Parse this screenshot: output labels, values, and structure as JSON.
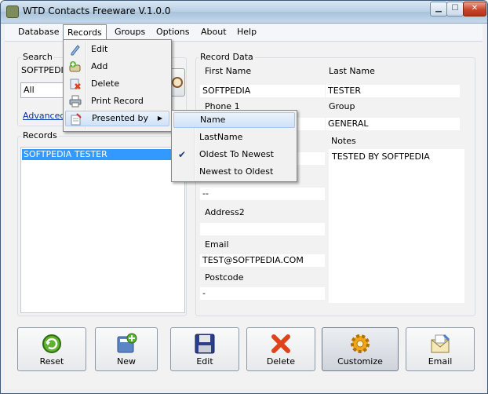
{
  "window": {
    "title": "WTD Contacts Freeware V.1.0.0",
    "min_glyph": "▁",
    "max_glyph": "☐",
    "close_glyph": "✕"
  },
  "menu": [
    {
      "label": "Database"
    },
    {
      "label": "Records"
    },
    {
      "label": "Groups"
    },
    {
      "label": "Options"
    },
    {
      "label": "About"
    },
    {
      "label": "Help"
    }
  ],
  "search": {
    "group_label": "Search",
    "value": "SOFTPEDIA",
    "scope": "All",
    "advanced_link": "Advanced"
  },
  "records": {
    "group_label": "Records",
    "items": [
      "SOFTPEDIA  TESTER"
    ]
  },
  "record_data": {
    "group_label": "Record Data",
    "first_name_label": "First Name",
    "first_name": "SOFTPEDIA",
    "last_name_label": "Last Name",
    "last_name": "TESTER",
    "phone1_label": "Phone 1",
    "phone1": "",
    "group_label_field": "Group",
    "group": "GENERAL",
    "notes_label": "Notes",
    "notes": "TESTED BY SOFTPEDIA",
    "phone2_value": "--",
    "address2_label": "Address2",
    "address2": "",
    "email_label": "Email",
    "email": "TEST@SOFTPEDIA.COM",
    "postcode_label": "Postcode",
    "postcode": "-"
  },
  "buttons": {
    "reset": "Reset",
    "new": "New",
    "edit": "Edit",
    "delete": "Delete",
    "customize": "Customize",
    "email": "Email"
  },
  "records_menu": {
    "items": [
      {
        "label": "Edit",
        "icon": "pencil-icon"
      },
      {
        "label": "Add",
        "icon": "add-icon"
      },
      {
        "label": "Delete",
        "icon": "delete-icon"
      },
      {
        "label": "Print Record",
        "icon": "printer-icon"
      },
      {
        "label": "Presented by",
        "icon": "notepad-icon"
      }
    ]
  },
  "presented_submenu": {
    "items": [
      {
        "label": "Name"
      },
      {
        "label": "LastName"
      },
      {
        "label": "Oldest To Newest",
        "checked": true,
        "check_glyph": "✔"
      },
      {
        "label": "Newest to Oldest"
      }
    ]
  },
  "colors": {
    "selection": "#3399ff",
    "link": "#0033aa",
    "close_button": "#c6452a"
  }
}
